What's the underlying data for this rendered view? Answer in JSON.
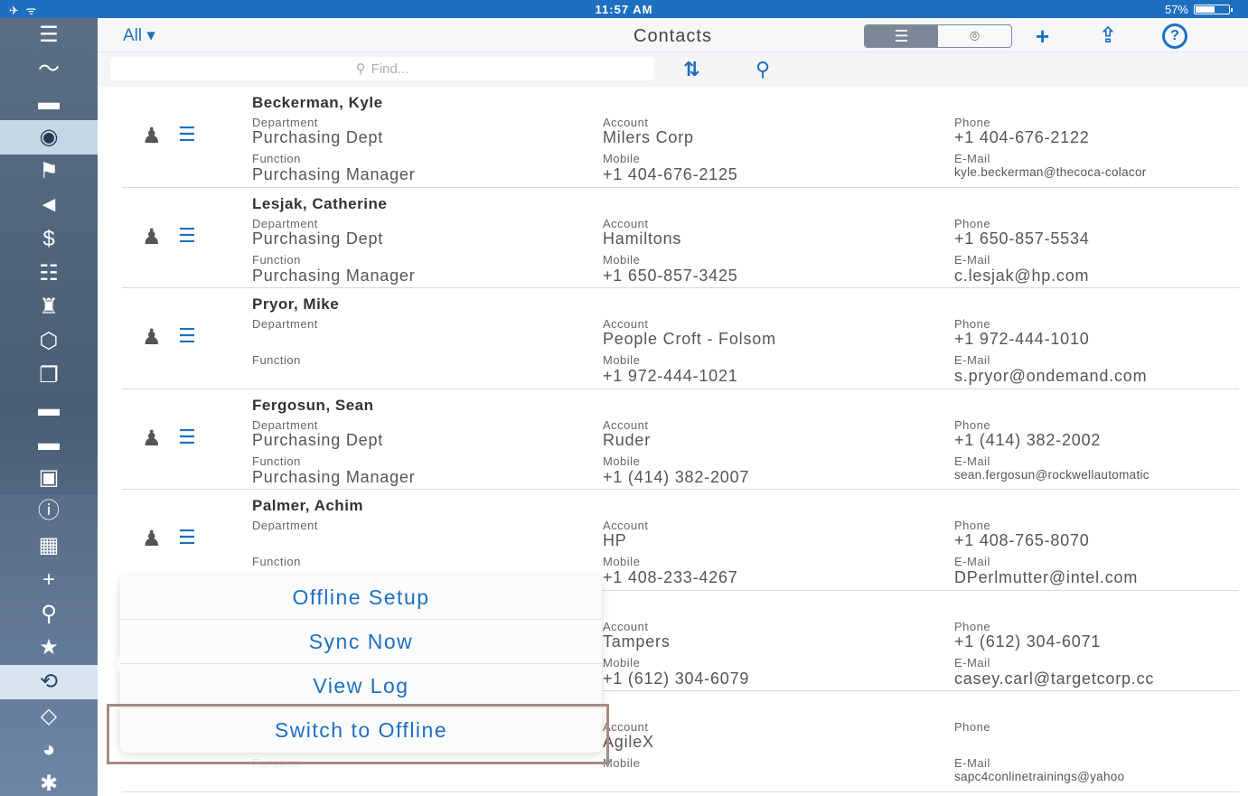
{
  "status_bar": {
    "left": "✈ ᯤ",
    "time": "11:57 AM",
    "battery_text": "57%",
    "battery_level": 0.57
  },
  "sidebar": {
    "items": [
      {
        "icon": "menu-icon",
        "glyph": "☰"
      },
      {
        "icon": "feed-icon",
        "glyph": "〜"
      },
      {
        "icon": "folder-icon",
        "glyph": "▬"
      },
      {
        "icon": "contacts-icon",
        "glyph": "◉",
        "active": true
      },
      {
        "icon": "accounts-icon",
        "glyph": "⚑"
      },
      {
        "icon": "campaigns-icon",
        "glyph": "◄"
      },
      {
        "icon": "opportunities-icon",
        "glyph": "$"
      },
      {
        "icon": "tasks-icon",
        "glyph": "☷"
      },
      {
        "icon": "competitors-icon",
        "glyph": "♜"
      },
      {
        "icon": "products-icon",
        "glyph": "⬡"
      },
      {
        "icon": "documents-icon",
        "glyph": "❐"
      },
      {
        "icon": "folder-icon-2",
        "glyph": "▬"
      },
      {
        "icon": "folder-icon-3",
        "glyph": "▬"
      },
      {
        "icon": "id-card-icon",
        "glyph": "▣"
      },
      {
        "icon": "alert-icon",
        "glyph": "ⓘ"
      },
      {
        "icon": "calendar-icon",
        "glyph": "▦"
      },
      {
        "icon": "add-icon",
        "glyph": "+"
      },
      {
        "icon": "search-icon",
        "glyph": "⚲"
      },
      {
        "icon": "favorites-icon",
        "glyph": "★"
      },
      {
        "icon": "sync-icon",
        "glyph": "⟲",
        "sync": true
      },
      {
        "icon": "tag-icon",
        "glyph": "◇"
      },
      {
        "icon": "pie-chart-icon",
        "glyph": "◕"
      },
      {
        "icon": "settings-icon",
        "glyph": "✱"
      },
      {
        "icon": "more-icon",
        "glyph": "•••"
      }
    ]
  },
  "toolbar": {
    "filter_label": "All ▾",
    "title": "Contacts",
    "view_list_glyph": "☰",
    "view_map_glyph": "⌾",
    "add_glyph": "+",
    "share_glyph": "⇪",
    "help_glyph": "?"
  },
  "search": {
    "placeholder": "Find...",
    "sort_glyph": "⇅",
    "zoom_glyph": "⚲"
  },
  "labels": {
    "department": "Department",
    "function": "Function",
    "account": "Account",
    "mobile": "Mobile",
    "phone": "Phone",
    "email": "E-Mail"
  },
  "contacts": [
    {
      "name": "Beckerman, Kyle",
      "department": "Purchasing Dept",
      "function": "Purchasing Manager",
      "account": "Milers Corp",
      "mobile": "+1 404-676-2125",
      "phone": "+1 404-676-2122",
      "email": "kyle.beckerman@thecoca-colacor"
    },
    {
      "name": "Lesjak, Catherine",
      "department": "Purchasing Dept",
      "function": "Purchasing Manager",
      "account": "Hamiltons",
      "mobile": "+1 650-857-3425",
      "phone": "+1 650-857-5534",
      "email": "c.lesjak@hp.com"
    },
    {
      "name": "Pryor, Mike",
      "department": "",
      "function": "",
      "account": "People Croft - Folsom",
      "mobile": "+1 972-444-1021",
      "phone": "+1 972-444-1010",
      "email": "s.pryor@ondemand.com"
    },
    {
      "name": "Fergosun, Sean",
      "department": "Purchasing Dept",
      "function": "Purchasing Manager",
      "account": "Ruder",
      "mobile": "+1 (414) 382-2007",
      "phone": "+1 (414) 382-2002",
      "email": "sean.fergosun@rockwellautomatic"
    },
    {
      "name": "Palmer, Achim",
      "department": "",
      "function": "",
      "account": "HP",
      "mobile": "+1 408-233-4267",
      "phone": "+1 408-765-8070",
      "email": "DPerlmutter@intel.com"
    },
    {
      "name": "",
      "department": "",
      "function": "",
      "account": "Tampers",
      "mobile": "+1 (612) 304-6079",
      "phone": "+1 (612) 304-6071",
      "email": "casey.carl@targetcorp.cc"
    },
    {
      "name": "",
      "department": "",
      "function": "",
      "account": "AgileX",
      "mobile": "",
      "phone": "",
      "email": "sapc4conlinetrainings@yahoo"
    }
  ],
  "popover": {
    "options": [
      "Offline Setup",
      "Sync Now",
      "View Log",
      "Switch to Offline"
    ]
  }
}
